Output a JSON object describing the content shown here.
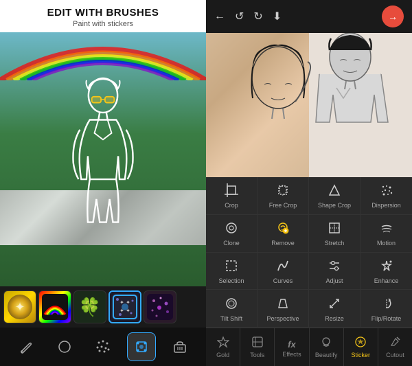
{
  "header": {
    "title": "EDIT WITH BRUSHES",
    "subtitle": "Paint with stickers"
  },
  "left_panel": {
    "stickers": [
      {
        "id": "gold",
        "emoji": "✨",
        "type": "gold"
      },
      {
        "id": "rainbow",
        "emoji": "🌈",
        "type": "rainbow"
      },
      {
        "id": "clover",
        "emoji": "🍀",
        "type": "clover"
      },
      {
        "id": "sparkle",
        "emoji": "✦",
        "type": "sparkle",
        "selected": true
      },
      {
        "id": "purple",
        "emoji": "✦",
        "type": "purple"
      }
    ],
    "tools": [
      {
        "id": "brush",
        "icon": "✏"
      },
      {
        "id": "erase",
        "icon": "○"
      },
      {
        "id": "scatter",
        "icon": "✦"
      },
      {
        "id": "sticker-tool",
        "icon": "⊞",
        "active": true
      },
      {
        "id": "eraser",
        "icon": "▭"
      }
    ]
  },
  "right_panel": {
    "topbar": {
      "back_icon": "←",
      "undo_icon": "↺",
      "redo_icon": "↻",
      "download_icon": "⬇",
      "next_icon": "→"
    },
    "tools": [
      {
        "id": "crop",
        "icon": "⊡",
        "label": "Crop"
      },
      {
        "id": "free-crop",
        "icon": "⬡",
        "label": "Free Crop"
      },
      {
        "id": "shape-crop",
        "icon": "△",
        "label": "Shape Crop"
      },
      {
        "id": "dispersion",
        "icon": "⁜",
        "label": "Dispersion"
      },
      {
        "id": "clone",
        "icon": "⊙",
        "label": "Clone"
      },
      {
        "id": "remove",
        "icon": "✦",
        "label": "Remove"
      },
      {
        "id": "stretch",
        "icon": "⊞",
        "label": "Stretch"
      },
      {
        "id": "motion",
        "icon": "☁",
        "label": "Motion"
      },
      {
        "id": "selection",
        "icon": "⬚",
        "label": "Selection"
      },
      {
        "id": "curves",
        "icon": "∿",
        "label": "Curves"
      },
      {
        "id": "adjust",
        "icon": "⊞",
        "label": "Adjust"
      },
      {
        "id": "enhance",
        "icon": "✺",
        "label": "Enhance"
      },
      {
        "id": "tilt-shift",
        "icon": "◎",
        "label": "Tilt Shift"
      },
      {
        "id": "perspective",
        "icon": "⬜",
        "label": "Perspective"
      },
      {
        "id": "resize",
        "icon": "⤡",
        "label": "Resize"
      },
      {
        "id": "flip-rotate",
        "icon": "⟳",
        "label": "Flip/Rotate"
      }
    ],
    "bottom_nav": [
      {
        "id": "gold",
        "icon": "♛",
        "label": "Gold"
      },
      {
        "id": "tools",
        "icon": "⊡",
        "label": "Tools"
      },
      {
        "id": "effects",
        "icon": "fx",
        "label": "Effects"
      },
      {
        "id": "beautify",
        "icon": "☺",
        "label": "Beautify"
      },
      {
        "id": "sticker",
        "icon": "⭐",
        "label": "Sticker",
        "active": true
      },
      {
        "id": "cutout",
        "icon": "✂",
        "label": "Cutout"
      }
    ]
  }
}
